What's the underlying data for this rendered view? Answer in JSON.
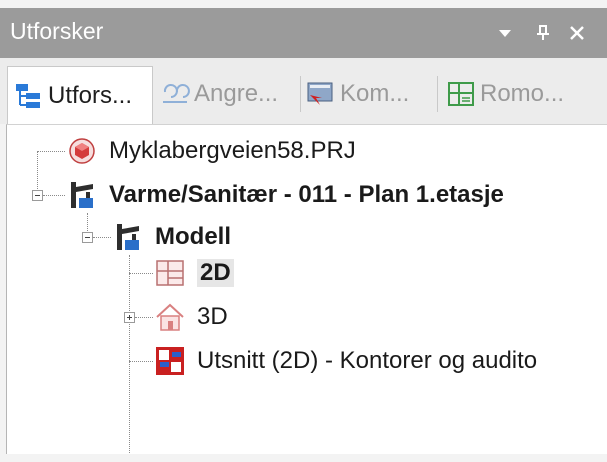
{
  "panel": {
    "title": "Utforsker",
    "buttons": [
      {
        "name": "dropdown",
        "icon": "chevron-down-icon"
      },
      {
        "name": "pin",
        "icon": "pin-icon"
      },
      {
        "name": "close",
        "icon": "close-icon"
      }
    ]
  },
  "tabs": [
    {
      "label": "Utfors...",
      "icon": "explorer-tree-icon",
      "active": true
    },
    {
      "label": "Angre...",
      "icon": "undo-history-icon",
      "active": false
    },
    {
      "label": "Kom...",
      "icon": "component-icon",
      "active": false
    },
    {
      "label": "Romo...",
      "icon": "room-overview-icon",
      "active": false
    }
  ],
  "tree": [
    {
      "label": "Myklabergveien58.PRJ",
      "icon": "project-icon",
      "bold": false,
      "level": 0
    },
    {
      "label": "Varme/Sanitær - 011 - Plan 1.etasje",
      "icon": "faucet-icon",
      "bold": true,
      "level": 0,
      "expanded": true
    },
    {
      "label": "Modell",
      "icon": "faucet-icon",
      "bold": true,
      "level": 1,
      "expanded": true
    },
    {
      "label": "2D",
      "icon": "floorplan-2d-icon",
      "bold": true,
      "level": 2,
      "selected": true
    },
    {
      "label": "3D",
      "icon": "house-3d-icon",
      "bold": false,
      "level": 2,
      "expanded": false
    },
    {
      "label": "Utsnitt (2D) - Kontorer og audito",
      "icon": "view-cutout-icon",
      "bold": false,
      "level": 2
    }
  ],
  "colors": {
    "titlebar": "#9b9b9b",
    "tab_active_bg": "#ffffff",
    "tab_inactive_text": "#9a9a9a",
    "selection": "#e6e6e6"
  }
}
